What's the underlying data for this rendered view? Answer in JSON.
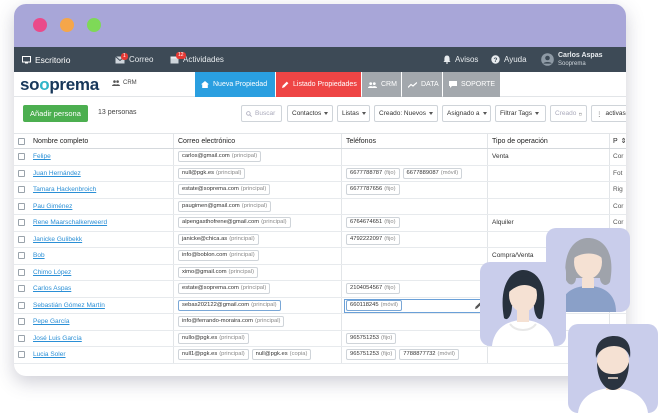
{
  "nav": {
    "desk": "Escritorio",
    "mail": "Correo",
    "mail_badge": "1",
    "activities": "Actividades",
    "activities_badge": "12",
    "alerts": "Avisos",
    "help": "Ayuda",
    "user_name": "Carlos Aspas",
    "user_org": "Sooprema"
  },
  "brand": {
    "logo_a": "so",
    "logo_b": "o",
    "logo_c": "prema",
    "crm_tag": "CRM",
    "tabs": [
      "Nueva Propiedad",
      "Listado Propiedades",
      "CRM",
      "DATA",
      "SOPORTE"
    ]
  },
  "toolbar": {
    "add": "Añadir persona",
    "count": "13 personas",
    "search_placeholder": "Buscar",
    "contacts": "Contactos",
    "lists": "Listas",
    "created": "Creado: Nuevos",
    "assigned": "Asignado a",
    "filter_tags": "Filtrar Tags",
    "created_date_placeholder": "Creado",
    "active": "activas"
  },
  "table": {
    "headers": [
      "Nombre completo",
      "Correo electrónico",
      "Teléfonos",
      "Tipo de operación",
      "P"
    ],
    "rows": [
      {
        "name": "Felipe",
        "emails": [
          [
            "carlos@gmail.com",
            "(principal)"
          ]
        ],
        "phones": [],
        "op": "Venta",
        "extra": "Cor"
      },
      {
        "name": "Juan Hernández",
        "emails": [
          [
            "null@pgk.es",
            "(principal)"
          ]
        ],
        "phones": [
          [
            "6677788787",
            "(fijo)"
          ],
          [
            "6677889087",
            "(móvil)"
          ]
        ],
        "op": "",
        "extra": "Fot"
      },
      {
        "name": "Tamara Hackenbroich",
        "emails": [
          [
            "estate@soprema.com",
            "(principal)"
          ]
        ],
        "phones": [
          [
            "6677787656",
            "(fijo)"
          ]
        ],
        "op": "",
        "extra": "Rig"
      },
      {
        "name": "Pau Giménez",
        "emails": [
          [
            "paugimen@gmail.com",
            "(principal)"
          ]
        ],
        "phones": [],
        "op": "",
        "extra": "Cor"
      },
      {
        "name": "Rene Maarschalkerweerd",
        "emails": [
          [
            "alpengasthofrene@gmail.com",
            "(principal)"
          ]
        ],
        "phones": [
          [
            "6764674651",
            "(fijo)"
          ]
        ],
        "op": "Alquiler",
        "extra": "Cor"
      },
      {
        "name": "Janicke Gulibekk",
        "emails": [
          [
            "janicke@chica.as",
            "(principal)"
          ]
        ],
        "phones": [
          [
            "4792222097",
            "(fijo)"
          ]
        ],
        "op": "",
        "extra": "Cor"
      },
      {
        "name": "Bob",
        "emails": [
          [
            "info@boblon.com",
            "(principal)"
          ]
        ],
        "phones": [],
        "op": "Compra/Venta",
        "extra": "Ide"
      },
      {
        "name": "Chimo López",
        "emails": [
          [
            "ximo@gmail.com",
            "(principal)"
          ]
        ],
        "phones": [],
        "op": "",
        "extra": "Ide"
      },
      {
        "name": "Carlos Aspas",
        "emails": [
          [
            "estate@soprema.com",
            "(principal)"
          ]
        ],
        "phones": [
          [
            "2104054567",
            "(fijo)"
          ]
        ],
        "op": "",
        "extra": ""
      },
      {
        "name": "Sebastián Gómez Martín",
        "emails": [
          [
            "sebas202122@gmail.com",
            "(principal)"
          ]
        ],
        "phones": [
          [
            "660118245",
            "(móvil)"
          ]
        ],
        "op": "",
        "extra": "Ide"
      },
      {
        "name": "Pepe García",
        "emails": [
          [
            "info@ferrando-moraira.com",
            "(principal)"
          ]
        ],
        "phones": [],
        "op": "",
        "extra": ""
      },
      {
        "name": "José Luis García",
        "emails": [
          [
            "nullo@pgk.es",
            "(principal)"
          ]
        ],
        "phones": [
          [
            "965751253",
            "(fijo)"
          ]
        ],
        "op": "",
        "extra": ""
      },
      {
        "name": "Lucia Soler",
        "emails": [
          [
            "null1@pgk.es",
            "(principal)"
          ],
          [
            "null@pgk.es",
            "(copia)"
          ]
        ],
        "phones": [
          [
            "965751253",
            "(fijo)"
          ],
          [
            "7788877732",
            "(móvil)"
          ]
        ],
        "op": "",
        "extra": ""
      }
    ]
  },
  "colors": {
    "titlebar": "#a8a6d8",
    "appbar": "#3d4a56",
    "tab_new": "#2a9fe0",
    "tab_list": "#ee4545",
    "tab_grey": "#a3a8ad",
    "add_button": "#4caf50",
    "link": "#2a8fd6"
  },
  "icons": [
    "monitor-icon",
    "mail-icon",
    "calendar-icon",
    "bell-icon",
    "help-icon",
    "user-icon",
    "home-icon",
    "pencil-icon",
    "users-icon",
    "chart-icon",
    "chat-icon",
    "search-icon",
    "calendar-icon"
  ]
}
